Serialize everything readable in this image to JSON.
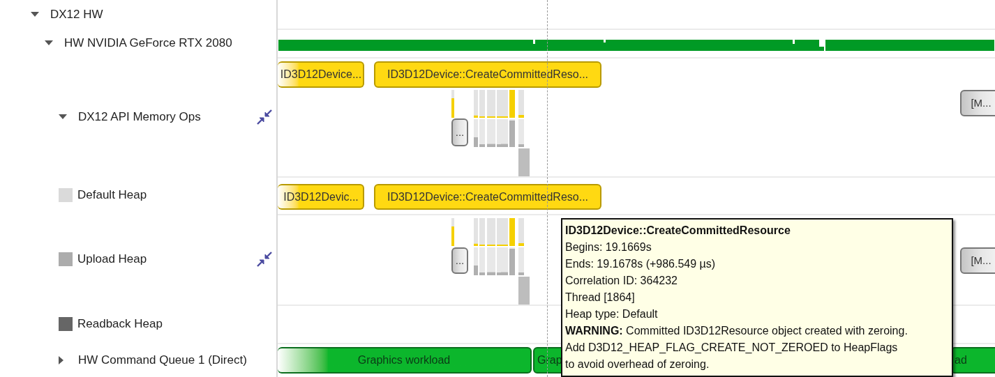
{
  "tree": [
    {
      "label": "DX12 HW",
      "kind": "group",
      "expanded": true,
      "children": [
        {
          "label": "HW NVIDIA GeForce RTX 2080",
          "kind": "group",
          "expanded": true,
          "track": {
            "kind": "utilization"
          },
          "children": [
            {
              "label": "DX12 API Memory Ops",
              "kind": "group",
              "expanded": true,
              "compact": true,
              "track": {
                "kind": "events",
                "bars": true,
                "events": [
                  {
                    "label": "ID3D12Device...",
                    "kind": "call"
                  },
                  {
                    "label": "ID3D12Device::CreateCommittedReso...",
                    "kind": "call"
                  },
                  {
                    "label": "...",
                    "kind": "more"
                  },
                  {
                    "label": "[M...",
                    "kind": "more"
                  }
                ]
              },
              "children": [
                {
                  "label": "Default Heap",
                  "kind": "legend",
                  "color": "#dadada",
                  "compact": false,
                  "track": {
                    "kind": "events",
                    "bars": false,
                    "events": [
                      {
                        "label": "ID3D12Devic...",
                        "kind": "call"
                      },
                      {
                        "label": "ID3D12Device::CreateCommittedReso...",
                        "kind": "call"
                      }
                    ]
                  }
                },
                {
                  "label": "Upload Heap",
                  "kind": "legend",
                  "color": "#acacac",
                  "compact": true,
                  "track": {
                    "kind": "events",
                    "bars": true,
                    "events": [
                      {
                        "label": "...",
                        "kind": "more"
                      },
                      {
                        "label": "[M...",
                        "kind": "more"
                      }
                    ]
                  }
                },
                {
                  "label": "Readback Heap",
                  "kind": "legend",
                  "color": "#666666",
                  "compact": false
                }
              ]
            },
            {
              "label": "HW Command Queue 1 (Direct)",
              "kind": "group",
              "expanded": false,
              "track": {
                "kind": "events",
                "bars": false,
                "events": [
                  {
                    "label": "Graphics workload",
                    "kind": "workload"
                  },
                  {
                    "label": "Grap",
                    "kind": "workload"
                  },
                  {
                    "label": "ad",
                    "kind": "workload"
                  }
                ]
              }
            }
          ]
        }
      ]
    }
  ],
  "tooltip": {
    "title": "ID3D12Device::CreateCommittedResource",
    "lines": [
      "Begins: 19.1669s",
      "Ends: 19.1678s (+986.549 µs)",
      "Correlation ID: 364232",
      "Thread [1864]",
      "Heap type: Default",
      "**WARNING:** Committed ID3D12Resource object created with zeroing.",
      "Add D3D12_HEAP_FLAG_CREATE_NOT_ZEROED to HeapFlags",
      "to avoid overhead of zeroing."
    ]
  }
}
